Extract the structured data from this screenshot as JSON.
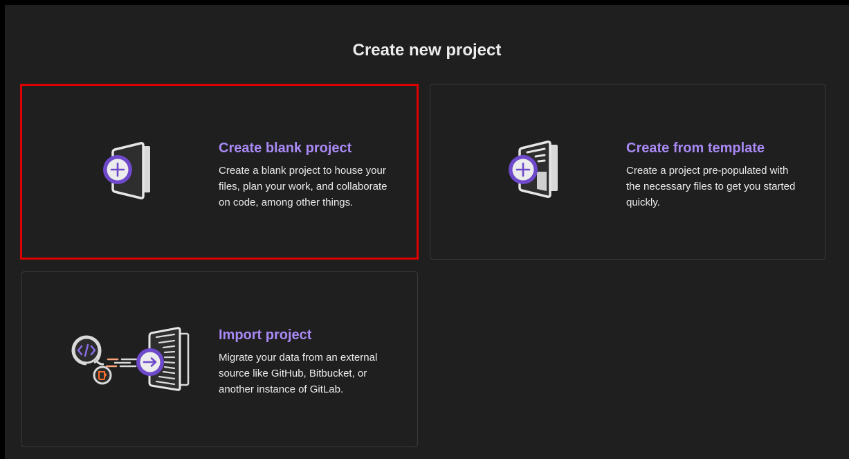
{
  "page": {
    "title": "Create new project"
  },
  "cards": [
    {
      "title": "Create blank project",
      "description": "Create a blank project to house your files, plan your work, and collaborate on code, among other things.",
      "icon": "blank-project-illustration",
      "highlighted": true
    },
    {
      "title": "Create from template",
      "description": "Create a project pre-populated with the necessary files to get you started quickly.",
      "icon": "template-project-illustration",
      "highlighted": false
    },
    {
      "title": "Import project",
      "description": "Migrate your data from an external source like GitHub, Bitbucket, or another instance of GitLab.",
      "icon": "import-project-illustration",
      "highlighted": false
    }
  ],
  "colors": {
    "background": "#1f1f1f",
    "card_border": "#3a3a3a",
    "highlight_border": "#dd0000",
    "accent_purple": "#a989f5",
    "icon_purple": "#6e49cb",
    "icon_orange": "#fc6d26",
    "text": "#ececec"
  }
}
